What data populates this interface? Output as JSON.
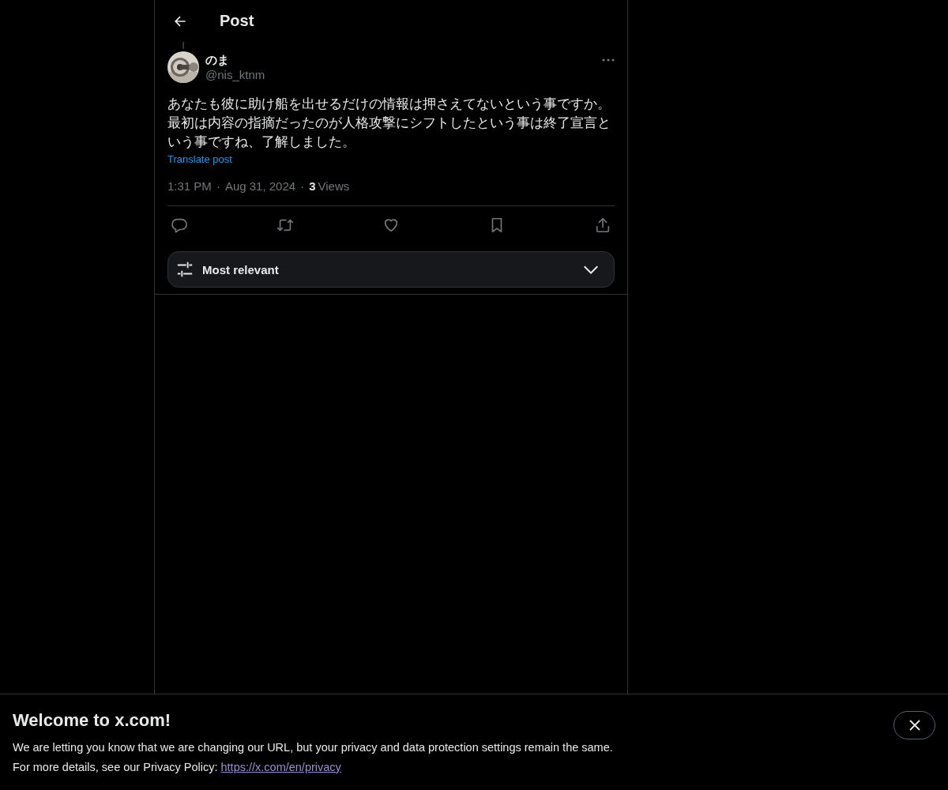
{
  "header": {
    "title": "Post"
  },
  "post": {
    "display_name": "のま",
    "handle": "@nis_ktnm",
    "text": "あなたも彼に助け船を出せるだけの情報は押さえてないという事ですか。最初は内容の指摘だったのが人格攻撃にシフトしたという事は終了宣言という事ですね、了解しました。",
    "translate": "Translate post",
    "time": "1:31 PM",
    "separator": "·",
    "date": "Aug 31, 2024",
    "views_count": "3",
    "views_label": "Views"
  },
  "sort": {
    "label": "Most relevant"
  },
  "banner": {
    "title": "Welcome to x.com!",
    "line_1": "We are letting you know that we are changing our URL, but your privacy and data protection settings remain the same.",
    "line_2": "For more details, see our Privacy Policy: ",
    "link": "https://x.com/en/privacy"
  }
}
